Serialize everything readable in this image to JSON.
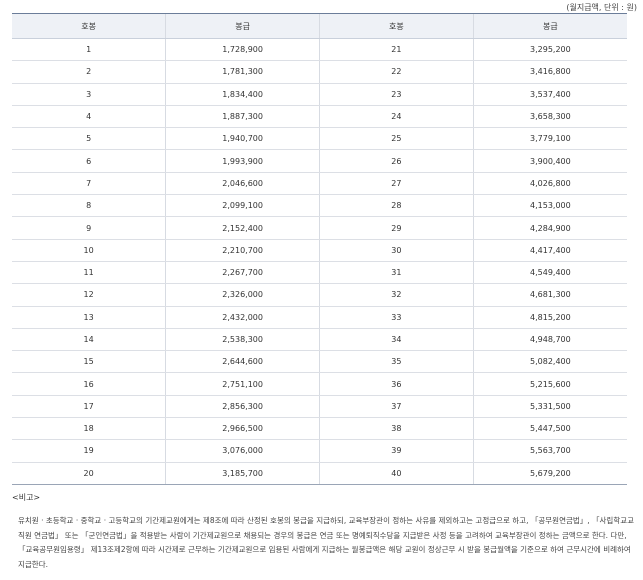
{
  "unit_note": "(월지급액, 단위 : 원)",
  "headers": {
    "step1": "호봉",
    "pay1": "봉급",
    "step2": "호봉",
    "pay2": "봉급"
  },
  "rows": [
    [
      "1",
      "1,728,900",
      "21",
      "3,295,200"
    ],
    [
      "2",
      "1,781,300",
      "22",
      "3,416,800"
    ],
    [
      "3",
      "1,834,400",
      "23",
      "3,537,400"
    ],
    [
      "4",
      "1,887,300",
      "24",
      "3,658,300"
    ],
    [
      "5",
      "1,940,700",
      "25",
      "3,779,100"
    ],
    [
      "6",
      "1,993,900",
      "26",
      "3,900,400"
    ],
    [
      "7",
      "2,046,600",
      "27",
      "4,026,800"
    ],
    [
      "8",
      "2,099,100",
      "28",
      "4,153,000"
    ],
    [
      "9",
      "2,152,400",
      "29",
      "4,284,900"
    ],
    [
      "10",
      "2,210,700",
      "30",
      "4,417,400"
    ],
    [
      "11",
      "2,267,700",
      "31",
      "4,549,400"
    ],
    [
      "12",
      "2,326,000",
      "32",
      "4,681,300"
    ],
    [
      "13",
      "2,432,000",
      "33",
      "4,815,200"
    ],
    [
      "14",
      "2,538,300",
      "34",
      "4,948,700"
    ],
    [
      "15",
      "2,644,600",
      "35",
      "5,082,400"
    ],
    [
      "16",
      "2,751,100",
      "36",
      "5,215,600"
    ],
    [
      "17",
      "2,856,300",
      "37",
      "5,331,500"
    ],
    [
      "18",
      "2,966,500",
      "38",
      "5,447,500"
    ],
    [
      "19",
      "3,076,000",
      "39",
      "5,563,700"
    ],
    [
      "20",
      "3,185,700",
      "40",
      "5,679,200"
    ]
  ],
  "note_heading": "<비고>",
  "note_text": "유치원 · 초등학교 · 중학교 · 고등학교의 기간제교원에게는 제8조에 따라 산정된 호봉의 봉급을 지급하되, 교육부장관이 정하는 사유를 제외하고는 고정급으로 하고, 「공무원연금법」, 「사립학교교직원 연금법」 또는 「군인연금법」을 적용받는 사람이 기간제교원으로 채용되는 경우의 봉급은 연금 또는 명예퇴직수당을 지급받은 사정 등을 고려하여 교육부장관이 정하는 금액으로 한다. 다만, 「교육공무원임용령」 제13조제2항에 따라 시간제로 근무하는 기간제교원으로 임용된 사람에게 지급하는 월봉급액은 해당 교원이 정상근무 시 받을 봉급월액을 기준으로 하여 근무시간에 비례하여 지급한다."
}
